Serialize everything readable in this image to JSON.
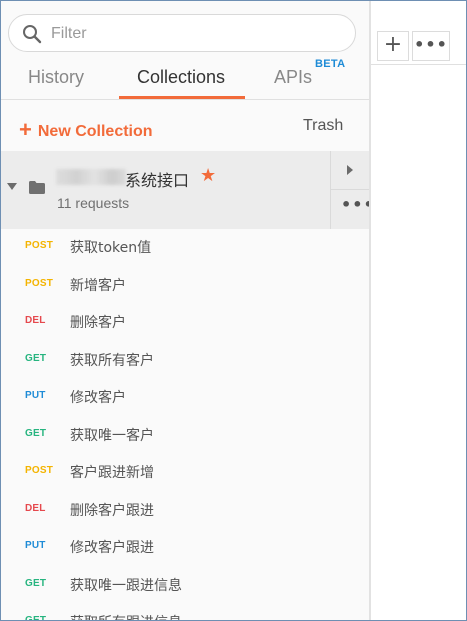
{
  "filter": {
    "placeholder": "Filter"
  },
  "tabs": [
    {
      "label": "History"
    },
    {
      "label": "Collections",
      "active": true
    },
    {
      "label": "APIs",
      "badge": "BETA"
    }
  ],
  "actions": {
    "new_collection": "New Collection",
    "trash": "Trash"
  },
  "collection": {
    "name": "系统接口",
    "count": "11 requests",
    "favorite": true
  },
  "requests": [
    {
      "method": "POST",
      "name": "获取token值"
    },
    {
      "method": "POST",
      "name": "新增客户"
    },
    {
      "method": "DEL",
      "name": "删除客户"
    },
    {
      "method": "GET",
      "name": "获取所有客户"
    },
    {
      "method": "PUT",
      "name": "修改客户"
    },
    {
      "method": "GET",
      "name": "获取唯一客户"
    },
    {
      "method": "POST",
      "name": "客户跟进新增"
    },
    {
      "method": "DEL",
      "name": "删除客户跟进"
    },
    {
      "method": "PUT",
      "name": "修改客户跟进"
    },
    {
      "method": "GET",
      "name": "获取唯一跟进信息"
    },
    {
      "method": "GET",
      "name": "获取所有跟进信息"
    }
  ],
  "toolbar": {
    "add": "+",
    "more": "•••"
  },
  "colors": {
    "accent": "#f26b3a",
    "post": "#f4b400",
    "get": "#26b47f",
    "del": "#e5484d",
    "put": "#1e8bd6"
  }
}
